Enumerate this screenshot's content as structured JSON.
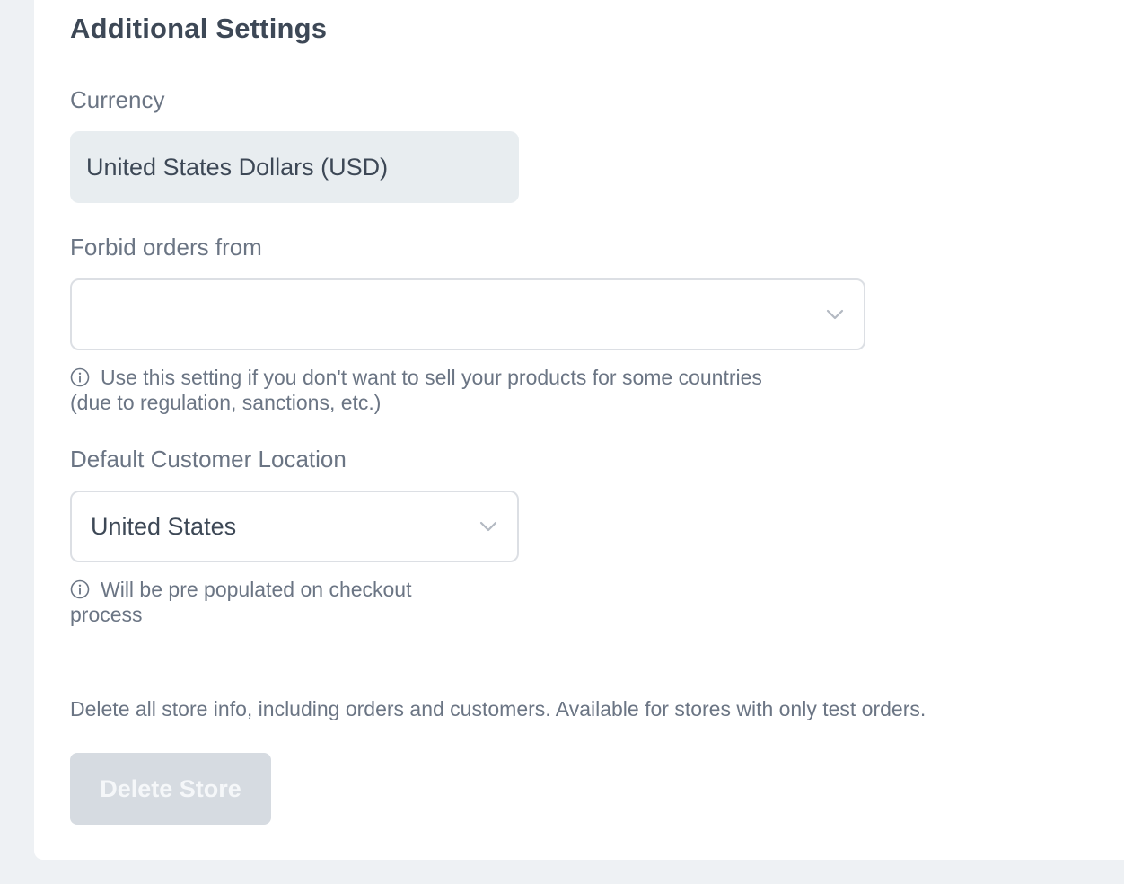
{
  "section": {
    "title": "Additional Settings"
  },
  "currency": {
    "label": "Currency",
    "value": "United States Dollars (USD)"
  },
  "forbid_orders": {
    "label": "Forbid orders from",
    "value": "",
    "hint_line1": "Use this setting if you don't want to sell your products for some countries",
    "hint_line2": "(due to regulation, sanctions, etc.)"
  },
  "default_location": {
    "label": "Default Customer Location",
    "value": "United States",
    "hint_line1": "Will be pre populated on checkout",
    "hint_line2": "process"
  },
  "danger_zone": {
    "description": "Delete all store info, including orders and customers. Available for stores with only test orders.",
    "delete_label": "Delete Store"
  },
  "icons": {
    "chevron": "chevron-down-icon",
    "info": "info-icon"
  },
  "colors": {
    "page_bg": "#eef1f4",
    "card_bg": "#ffffff",
    "readonly_field_bg": "#e8edf0",
    "disabled_button_bg": "#d6dbe1",
    "text_primary": "#3d4856",
    "text_secondary": "#6b7584"
  }
}
